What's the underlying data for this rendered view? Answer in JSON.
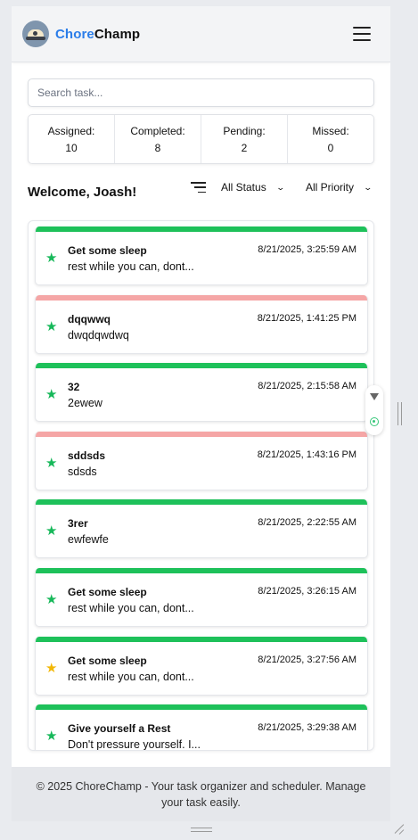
{
  "header": {
    "brand_first": "Chore",
    "brand_second": "Champ",
    "logo_icon": "hat-avatar-icon",
    "menu_icon": "hamburger-menu-icon"
  },
  "search": {
    "placeholder": "Search task...",
    "value": ""
  },
  "stats": [
    {
      "label": "Assigned:",
      "value": "10"
    },
    {
      "label": "Completed:",
      "value": "8"
    },
    {
      "label": "Pending:",
      "value": "2"
    },
    {
      "label": "Missed:",
      "value": "0"
    }
  ],
  "welcome": "Welcome, Joash!",
  "filters": {
    "filter_icon": "filter-lines-icon",
    "status": "All Status",
    "priority": "All Priority"
  },
  "colors": {
    "brand_blue": "#2b7de9",
    "bar_green": "#1ec15a",
    "bar_pink": "#f5a6a6",
    "star_green": "#17b85a",
    "star_gold": "#f2b705"
  },
  "tasks": [
    {
      "title": "Get some sleep",
      "desc": "rest while you can, dont...",
      "timestamp": "8/21/2025, 3:25:59 AM",
      "bar": "green",
      "star": "green"
    },
    {
      "title": "dqqwwq",
      "desc": "dwqdqwdwq",
      "timestamp": "8/21/2025, 1:41:25 PM",
      "bar": "pink",
      "star": "green"
    },
    {
      "title": "32",
      "desc": "2ewew",
      "timestamp": "8/21/2025, 2:15:58 AM",
      "bar": "green",
      "star": "green"
    },
    {
      "title": "sddsds",
      "desc": "sdsds",
      "timestamp": "8/21/2025, 1:43:16 PM",
      "bar": "pink",
      "star": "green"
    },
    {
      "title": "3rer",
      "desc": "ewfewfe",
      "timestamp": "8/21/2025, 2:22:55 AM",
      "bar": "green",
      "star": "green"
    },
    {
      "title": "Get some sleep",
      "desc": "rest while you can, dont...",
      "timestamp": "8/21/2025, 3:26:15 AM",
      "bar": "green",
      "star": "green"
    },
    {
      "title": "Get some sleep",
      "desc": "rest while you can, dont...",
      "timestamp": "8/21/2025, 3:27:56 AM",
      "bar": "green",
      "star": "gold"
    },
    {
      "title": "Give yourself a Rest",
      "desc": "Don't pressure yourself. I...",
      "timestamp": "8/21/2025, 3:29:38 AM",
      "bar": "green",
      "star": "green"
    }
  ],
  "footer": "© 2025 ChoreChamp - Your task organizer and scheduler. Manage your task easily."
}
